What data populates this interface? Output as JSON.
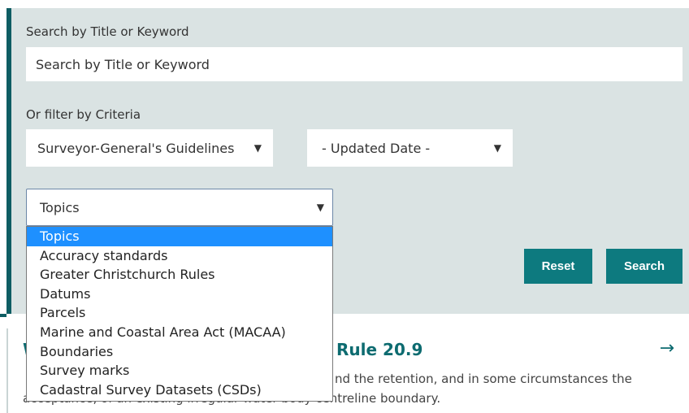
{
  "search": {
    "label": "Search by Title or Keyword",
    "placeholder": "Search by Title or Keyword"
  },
  "filter": {
    "label": "Or filter by Criteria",
    "category_select": "Surveyor-General's Guidelines",
    "date_select": "- Updated Date -",
    "topics_select": "Topics",
    "topics_options": [
      "Topics",
      "Accuracy standards",
      "Greater Christchurch Rules",
      "Datums",
      "Parcels",
      "Marine and Coastal Area Act (MACAA)",
      "Boundaries",
      "Survey marks",
      "Cadastral Survey Datasets (CSDs)"
    ],
    "topics_selected_index": 0
  },
  "buttons": {
    "reset": "Reset",
    "search": "Search"
  },
  "result": {
    "title_visible": "Rule 20.9",
    "title_prefix": "W",
    "description_line1": "nd the retention, and in some circumstances the",
    "description_line2": "acceptance, of an existing irregular water body centreline boundary.",
    "arrow": "→"
  },
  "colors": {
    "accent": "#0d7a7f",
    "panel": "#dae3e3",
    "highlight": "#1e90ff"
  }
}
